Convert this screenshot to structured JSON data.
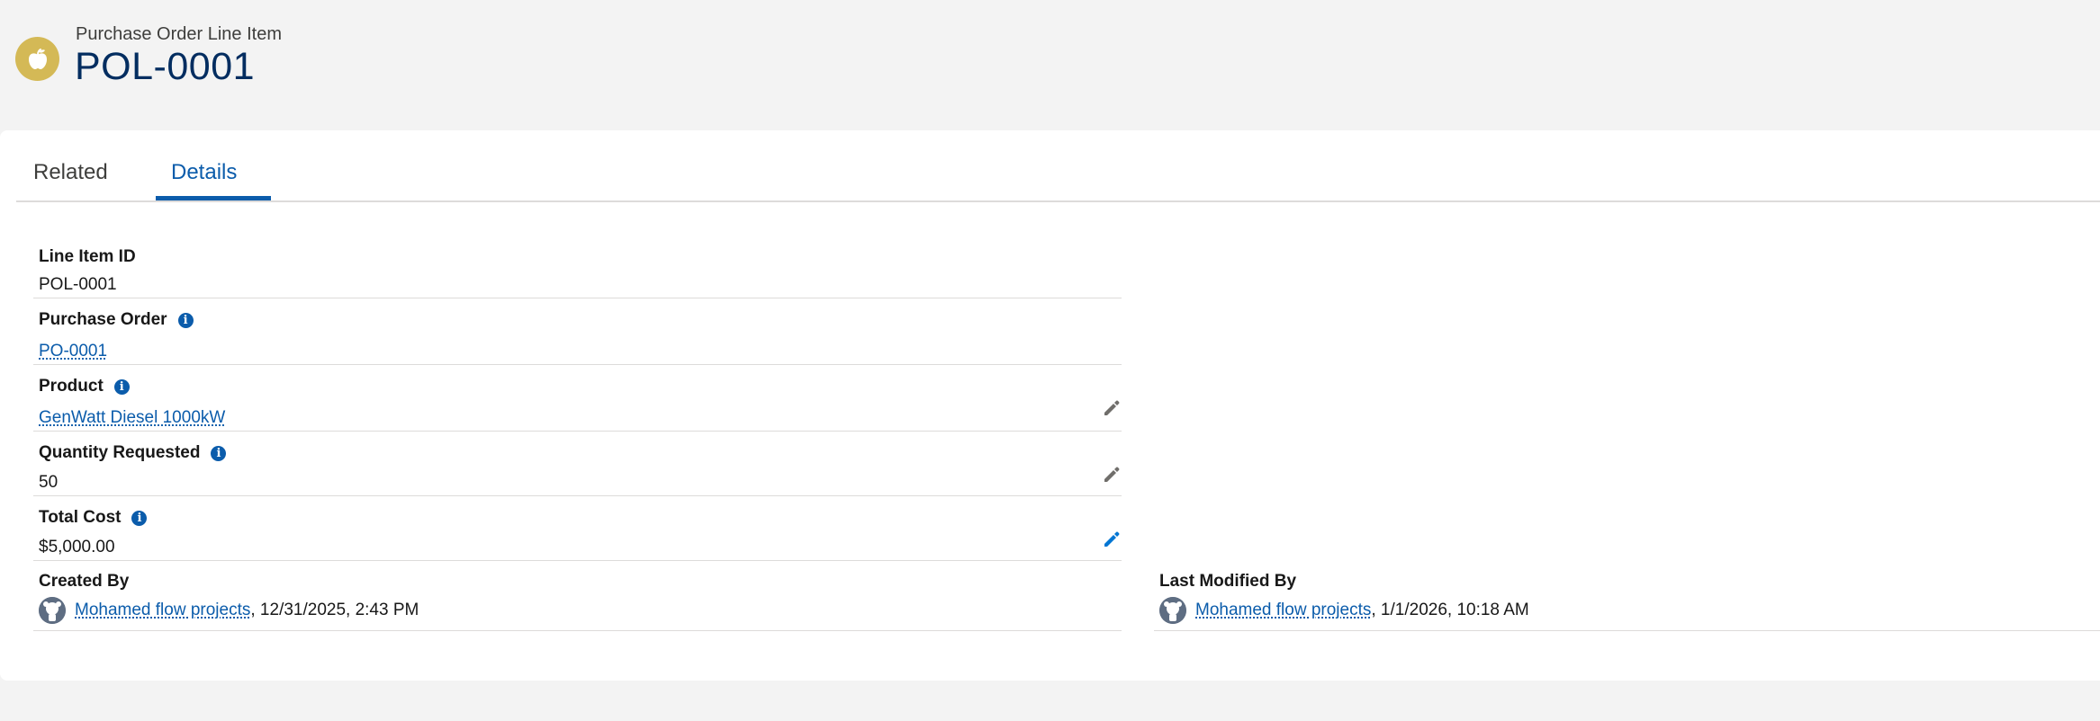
{
  "header": {
    "object_type": "Purchase Order Line Item",
    "record_name": "POL-0001",
    "icon": "apple-icon",
    "icon_color": "#d4b956"
  },
  "tabs": [
    {
      "label": "Related",
      "active": false
    },
    {
      "label": "Details",
      "active": true
    }
  ],
  "fields": {
    "line_item_id": {
      "label": "Line Item ID",
      "value": "POL-0001"
    },
    "purchase_order": {
      "label": "Purchase Order",
      "value": "PO-0001"
    },
    "product": {
      "label": "Product",
      "value": "GenWatt Diesel 1000kW"
    },
    "quantity_requested": {
      "label": "Quantity Requested",
      "value": "50"
    },
    "total_cost": {
      "label": "Total Cost",
      "value": "$5,000.00"
    },
    "created_by": {
      "label": "Created By",
      "user": "Mohamed flow projects",
      "date": ", 12/31/2025, 2:43 PM"
    },
    "last_modified_by": {
      "label": "Last Modified By",
      "user": "Mohamed flow projects",
      "date": ", 1/1/2026, 10:18 AM"
    }
  },
  "colors": {
    "accent": "#0b5cab",
    "title": "#032d60",
    "background": "#f3f3f3"
  }
}
